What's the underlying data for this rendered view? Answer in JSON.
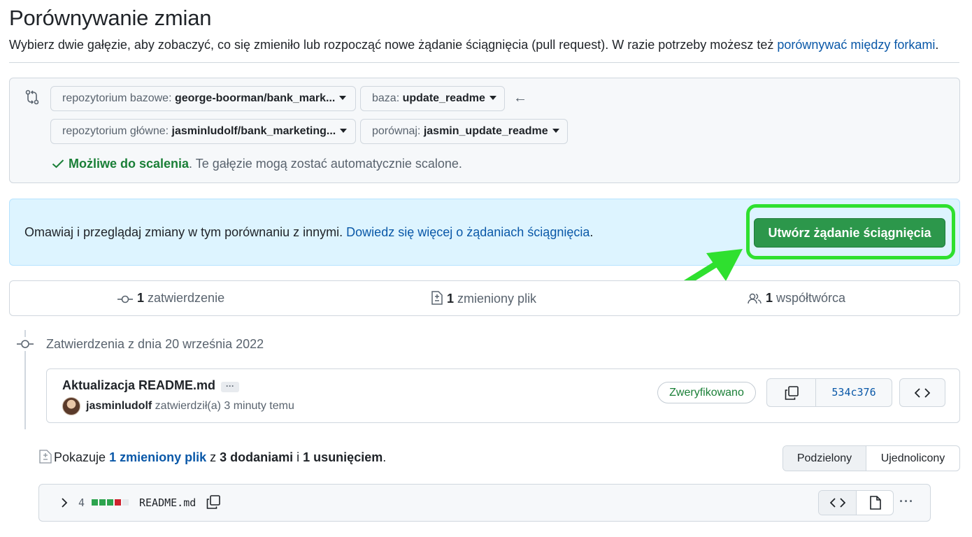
{
  "header": {
    "title": "Porównywanie zmian",
    "subtitle": "Wybierz dwie gałęzie, aby zobaczyć, co się zmieniło lub rozpocząć nowe żądanie ściągnięcia (pull request). W razie potrzeby możesz też ",
    "subtitle_link": "porównywać między forkami",
    "subtitle_end": "."
  },
  "range": {
    "base_repo_label": "repozytorium bazowe: ",
    "base_repo_value": "george-boorman/bank_mark...",
    "base_label": "baza: ",
    "base_value": "update_readme",
    "head_repo_label": "repozytorium główne: ",
    "head_repo_value": "jasminludolf/bank_marketing...",
    "compare_label": "porównaj: ",
    "compare_value": "jasmin_update_readme",
    "arrow": "←",
    "status_ok": "Możliwe do scalenia",
    "status_text": ". Te gałęzie mogą zostać automatycznie scalone."
  },
  "banner": {
    "text": "Omawiaj i przeglądaj zmiany w tym porównaniu z innymi. ",
    "link": "Dowiedz się więcej o żądaniach ściągnięcia",
    "text_end": ".",
    "button": "Utwórz żądanie ściągnięcia"
  },
  "summary": {
    "commits_count": "1",
    "commits_label": " zatwierdzenie",
    "files_count": "1",
    "files_label": " zmieniony plik",
    "contributors_count": "1",
    "contributors_label": " współtwórca"
  },
  "timeline": {
    "heading": "Zatwierdzenia z dnia 20 września 2022"
  },
  "commit": {
    "title": "Aktualizacja README.md",
    "ellipsis": "···",
    "author": "jasminludolf",
    "action": " zatwierdził(a) 3 minuty temu",
    "verified": "Zweryfikowano",
    "sha": "534c376"
  },
  "files": {
    "prefix": "Pokazuje ",
    "link": "1 zmieniony plik",
    "mid": " z ",
    "additions": "3 dodaniami",
    "and": " i ",
    "deletions": "1 usunięciem",
    "end": ".",
    "view_split": "Podzielony",
    "view_unified": "Ujednolicony"
  },
  "file_row": {
    "changes": "4",
    "name": "README.md",
    "more": "···",
    "diff_blocks": [
      "#2da44e",
      "#2da44e",
      "#2da44e",
      "#cf222e",
      "#e6e9ec"
    ]
  },
  "colors": {
    "accent_link": "#0a58a8",
    "success": "#1a7f37",
    "create_button": "#2c974b",
    "highlight": "#2fe02f"
  },
  "icons": [
    "compare-icon",
    "arrow-left-icon",
    "check-icon",
    "commit-icon",
    "file-diff-icon",
    "people-icon",
    "copy-icon",
    "code-icon",
    "chevron-right-icon",
    "file-icon",
    "kebab-icon"
  ]
}
